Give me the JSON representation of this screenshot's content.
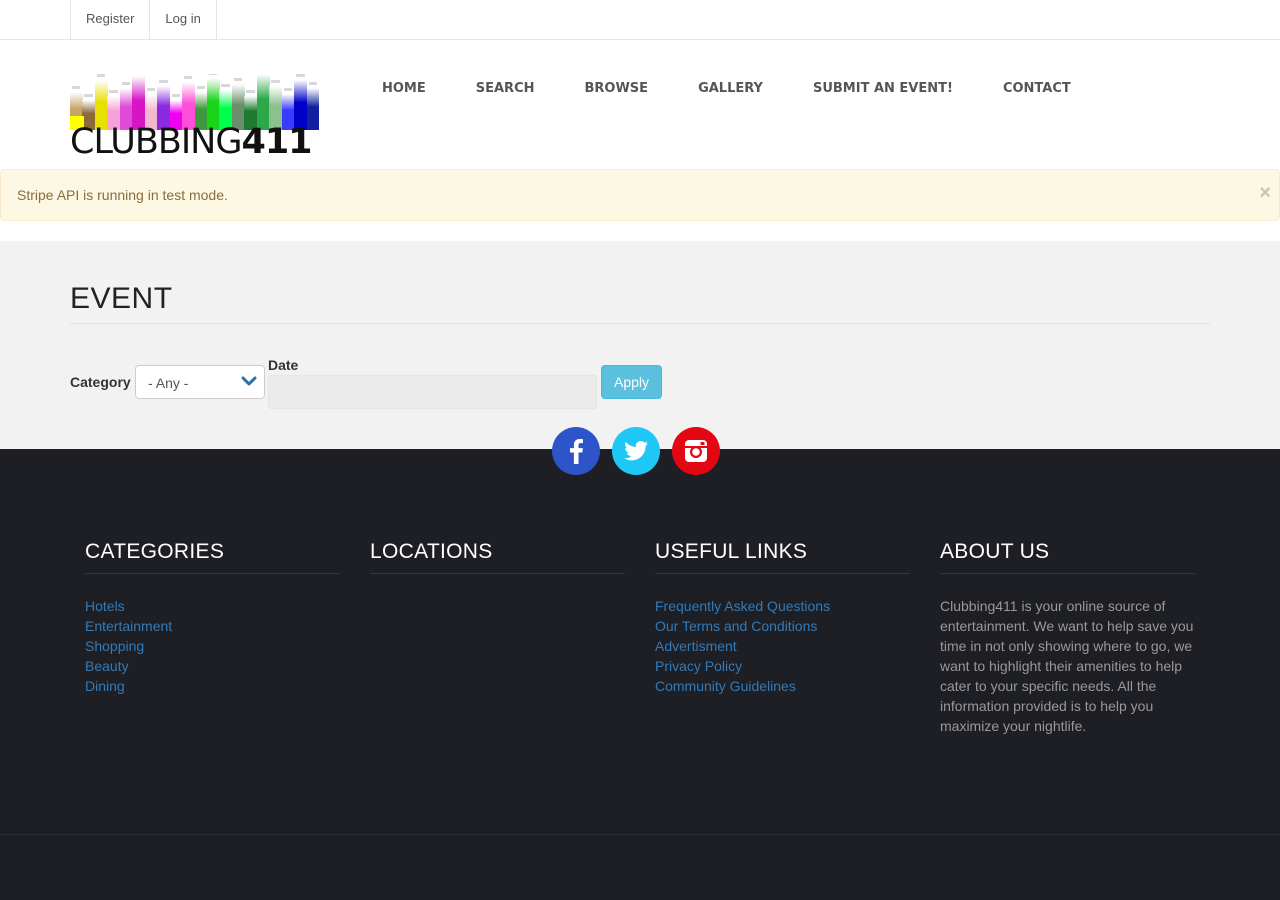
{
  "topbar": {
    "register": "Register",
    "login": "Log in"
  },
  "logo": {
    "text_thin": "CLUBBING",
    "text_bold": "411"
  },
  "nav": {
    "items": [
      "HOME",
      "SEARCH",
      "BROWSE",
      "GALLERY",
      "SUBMIT AN EVENT!",
      "CONTACT"
    ]
  },
  "alert": {
    "message": "Stripe API is running in test mode.",
    "close": "×"
  },
  "page": {
    "title": "EVENT",
    "filters": {
      "category_label": "Category",
      "category_value": "- Any -",
      "date_label": "Date",
      "date_value": "",
      "apply": "Apply"
    }
  },
  "social": [
    {
      "name": "facebook-icon",
      "color": "#2e54c9"
    },
    {
      "name": "twitter-icon",
      "color": "#1fc7f4"
    },
    {
      "name": "instagram-icon",
      "color": "#e30613"
    }
  ],
  "footer": {
    "categories": {
      "title": "CATEGORIES",
      "items": [
        "Hotels",
        "Entertainment",
        "Shopping",
        "Beauty",
        "Dining"
      ]
    },
    "locations": {
      "title": "LOCATIONS"
    },
    "useful_links": {
      "title": "USEFUL LINKS",
      "items": [
        "Frequently Asked Questions",
        "Our Terms and Conditions",
        "Advertisment",
        "Privacy Policy",
        "Community Guidelines"
      ]
    },
    "about": {
      "title": "ABOUT US",
      "text": "Clubbing411 is your online source of entertainment. We want to help save you time in not only showing where to go, we want to highlight their amenities to help cater to your specific needs. All the information provided is to help you maximize your nightlife."
    }
  },
  "colors": {
    "link": "#337ab7",
    "footer_bg": "#1e1f24",
    "content_bg": "#f2f2f2",
    "alert_bg": "#fcf8e3",
    "apply_bg": "#5bc0de"
  }
}
